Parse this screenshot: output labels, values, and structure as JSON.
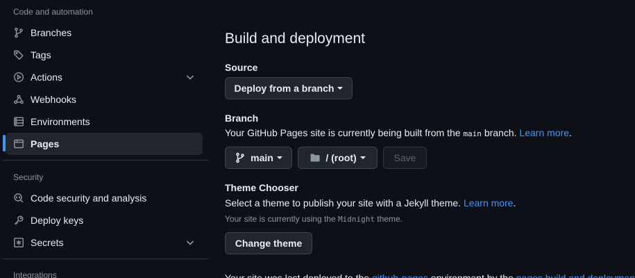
{
  "sidebar": {
    "groups": [
      {
        "title": "Code and automation"
      },
      {
        "title": "Security"
      },
      {
        "title": "Integrations"
      }
    ],
    "items": [
      {
        "label": "Branches",
        "icon": "branch-icon"
      },
      {
        "label": "Tags",
        "icon": "tag-icon"
      },
      {
        "label": "Actions",
        "icon": "play-icon",
        "expandable": true
      },
      {
        "label": "Webhooks",
        "icon": "webhook-icon"
      },
      {
        "label": "Environments",
        "icon": "server-icon"
      },
      {
        "label": "Pages",
        "icon": "browser-icon",
        "active": true
      },
      {
        "label": "Code security and analysis",
        "icon": "codescan-icon"
      },
      {
        "label": "Deploy keys",
        "icon": "key-icon"
      },
      {
        "label": "Secrets",
        "icon": "asterisk-icon",
        "expandable": true
      }
    ]
  },
  "main": {
    "heading": "Build and deployment",
    "source": {
      "label": "Source",
      "dropdown": "Deploy from a branch"
    },
    "branch": {
      "label": "Branch",
      "desc_before": "Your GitHub Pages site is currently being built from the ",
      "desc_code": "main",
      "desc_after": " branch. ",
      "learn_more": "Learn more",
      "period": ".",
      "branch_button": "main",
      "folder_button": "/ (root)",
      "save_button": "Save"
    },
    "theme": {
      "label": "Theme Chooser",
      "desc": "Select a theme to publish your site with a Jekyll theme. ",
      "learn_more": "Learn more",
      "period": ".",
      "note_before": "Your site is currently using the ",
      "note_code": "Midnight",
      "note_after": " theme.",
      "change_button": "Change theme"
    },
    "footer": {
      "before": "Your site was last deployed to the ",
      "env_link": "github-pages",
      "middle": " environment by the ",
      "workflow_link": "pages build and deployment"
    }
  },
  "colors": {
    "background": "#0d1117",
    "accent": "#4493f8",
    "button_bg": "#21262d",
    "border": "#30363d",
    "muted": "#8d96a0"
  }
}
